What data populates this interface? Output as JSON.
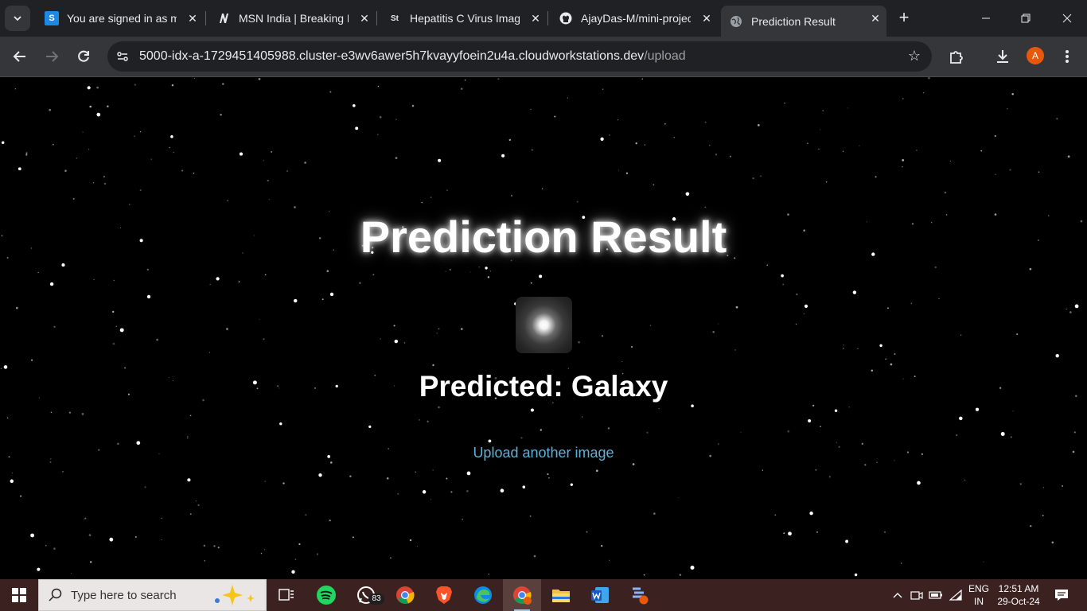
{
  "browser": {
    "tabs": [
      {
        "title": "You are signed in as m",
        "icon": "s-favicon",
        "active": false
      },
      {
        "title": "MSN India | Breaking N",
        "icon": "msn-favicon",
        "active": false
      },
      {
        "title": "Hepatitis C Virus Image",
        "icon": "st-favicon",
        "active": false
      },
      {
        "title": "AjayDas-M/mini-projec",
        "icon": "github-favicon",
        "active": false
      },
      {
        "title": "Prediction Result",
        "icon": "globe-favicon",
        "active": true
      }
    ],
    "favicon_text": {
      "s": "S",
      "st": "St"
    },
    "url_host": "5000-idx-a-1729451405988.cluster-e3wv6awer5h7kvayyfoein2u4a.cloudworkstations.dev",
    "url_path": "/upload",
    "profile_initial": "A"
  },
  "page": {
    "heading": "Prediction Result",
    "predicted_text": "Predicted: Galaxy",
    "link_text": "Upload another image"
  },
  "taskbar": {
    "search_placeholder": "Type here to search",
    "whatsapp_badge": "83",
    "language_line1": "ENG",
    "language_line2": "IN",
    "time": "12:51 AM",
    "date": "29-Oct-24"
  },
  "colors": {
    "link": "#5fb1d8",
    "tab_bg": "#202124",
    "toolbar_bg": "#35363a",
    "taskbar_bg": "#3b2220",
    "avatar": "#e8580c"
  }
}
